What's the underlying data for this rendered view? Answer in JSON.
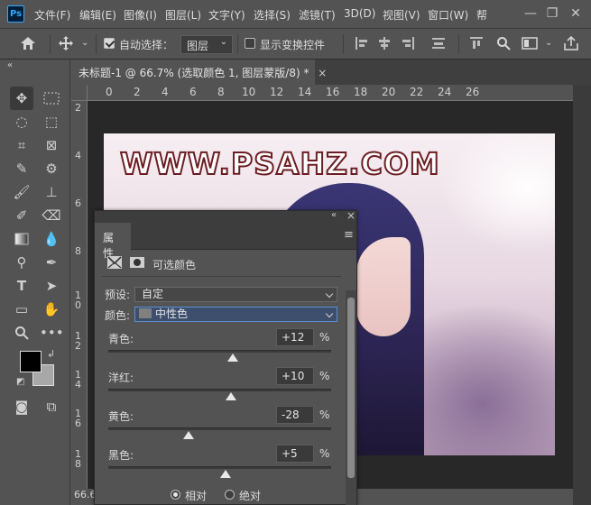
{
  "app": {
    "logo": "Ps"
  },
  "menubar": {
    "items": [
      "文件(F)",
      "编辑(E)",
      "图像(I)",
      "图层(L)",
      "文字(Y)",
      "选择(S)",
      "滤镜(T)",
      "3D(D)",
      "视图(V)",
      "窗口(W)",
      "帮"
    ],
    "window_buttons": [
      "—",
      "❐",
      "✕"
    ]
  },
  "options_bar": {
    "auto_select_label": "自动选择：",
    "auto_select_checked": true,
    "layer_target": "图层",
    "show_transform_label": "显示变换控件",
    "show_transform_checked": false
  },
  "document": {
    "tab_title": "未标题-1 @ 66.7% (选取颜色 1, 图层蒙版/8) *",
    "tab_close": "×",
    "ruler_h_ticks": [
      "0",
      "2",
      "4",
      "6",
      "8",
      "10",
      "12",
      "14",
      "16",
      "18",
      "20",
      "22",
      "24",
      "26"
    ],
    "ruler_v_ticks": [
      "2",
      "4",
      "6",
      "8",
      "1\n0",
      "1\n2",
      "1\n4",
      "1\n6",
      "1\n8"
    ],
    "zoom_status": "66.6",
    "watermark_text": "WWW.PSAHZ.COM"
  },
  "properties_panel": {
    "tab_label": "属性",
    "collapse_glyph": "«",
    "close_glyph": "×",
    "menu_glyph": "≡",
    "adjustment_title": "可选颜色",
    "preset_label": "预设:",
    "preset_value": "自定",
    "colors_label": "颜色:",
    "colors_value": "中性色",
    "swatch_color": "#808080",
    "sliders": [
      {
        "label": "青色:",
        "value": "+12",
        "unit": "%",
        "numeric": 12
      },
      {
        "label": "洋红:",
        "value": "+10",
        "unit": "%",
        "numeric": 10
      },
      {
        "label": "黄色:",
        "value": "-28",
        "unit": "%",
        "numeric": -28
      },
      {
        "label": "黑色:",
        "value": "+5",
        "unit": "%",
        "numeric": 5
      }
    ],
    "method_options": [
      "相对",
      "绝对"
    ],
    "method_selected": "相对"
  },
  "colors": {
    "ui_bg": "#535353",
    "canvas_bg": "#282828",
    "foreground": "#000000",
    "background": "#a8a8a8",
    "watermark_fill": "#ffffff",
    "watermark_stroke": "#6b1d22"
  }
}
